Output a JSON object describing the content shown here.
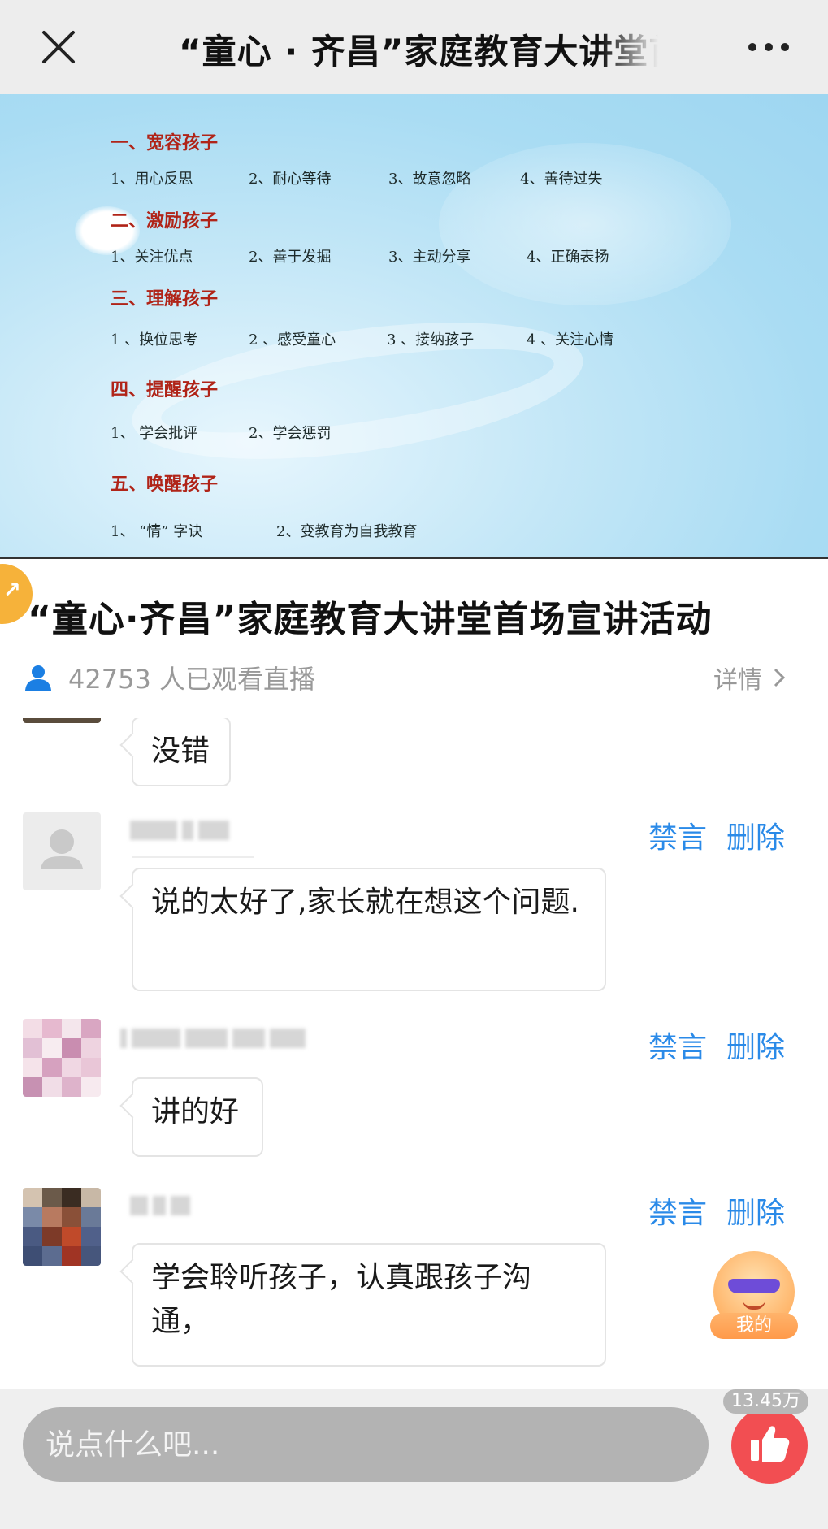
{
  "topbar": {
    "title": "“童心 · 齐昌”家庭教育大讲堂首场宣讲活动",
    "close_icon": "close-icon",
    "more_icon": "more-dots-icon"
  },
  "slide": {
    "sections": [
      {
        "heading": "一、宽容孩子",
        "items": [
          "1、用心反思",
          "2、耐心等待",
          "3、故意忽略",
          "4、善待过失"
        ]
      },
      {
        "heading": "二、激励孩子",
        "items": [
          "1、关注优点",
          "2、善于发掘",
          "3、主动分享",
          "4、正确表扬"
        ]
      },
      {
        "heading": "三、理解孩子",
        "items": [
          "1 、换位思考",
          "2 、感受童心",
          "3 、接纳孩子",
          "4 、关注心情"
        ]
      },
      {
        "heading": "四、提醒孩子",
        "items": [
          "1、 学会批评",
          "2、学会惩罚"
        ]
      },
      {
        "heading": "五、唤醒孩子",
        "items": [
          "1、 “情” 字诀",
          "2、变教育为自我教育"
        ]
      }
    ]
  },
  "info": {
    "title": "“童心·齐昌”家庭教育大讲堂首场宣讲活动",
    "viewers": "42753 人已观看直播",
    "details_label": "详情"
  },
  "comments": [
    {
      "text": "没错",
      "mute_label": "",
      "delete_label": ""
    },
    {
      "text": "说的太好了,家长就在想这个问题.",
      "mute_label": "禁言",
      "delete_label": "删除"
    },
    {
      "text": "讲的好",
      "mute_label": "禁言",
      "delete_label": "删除"
    },
    {
      "text": "学会聆听孩子，认真跟孩子沟通，",
      "mute_label": "禁言",
      "delete_label": "删除"
    }
  ],
  "mine": {
    "label": "我的"
  },
  "bottombar": {
    "input_placeholder": "说点什么吧...",
    "likes_count": "13.45万"
  },
  "colors": {
    "accent_blue": "#2a8ae8",
    "like_red": "#f24e52",
    "heading_red": "#b02418",
    "badge_orange": "#f6b23a"
  }
}
